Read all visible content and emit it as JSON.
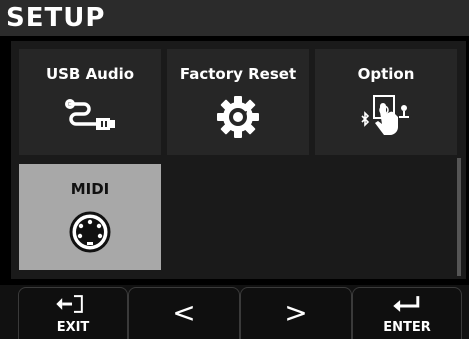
{
  "header": {
    "title": "SETUP"
  },
  "tiles": [
    {
      "label": "USB Audio",
      "icon": "usb-cable-icon",
      "selected": false
    },
    {
      "label": "Factory Reset",
      "icon": "gear-reset-icon",
      "selected": false
    },
    {
      "label": "Option",
      "icon": "option-touch-icon",
      "selected": false
    },
    {
      "label": "MIDI",
      "icon": "midi-din-icon",
      "selected": true
    }
  ],
  "footer": {
    "exit_label": "EXIT",
    "prev_label": "<",
    "next_label": ">",
    "enter_label": "ENTER"
  },
  "colors": {
    "background": "#000000",
    "tile": "#262626",
    "tile_selected": "#a8a8a8",
    "title_bar": "#2b2b2b"
  }
}
